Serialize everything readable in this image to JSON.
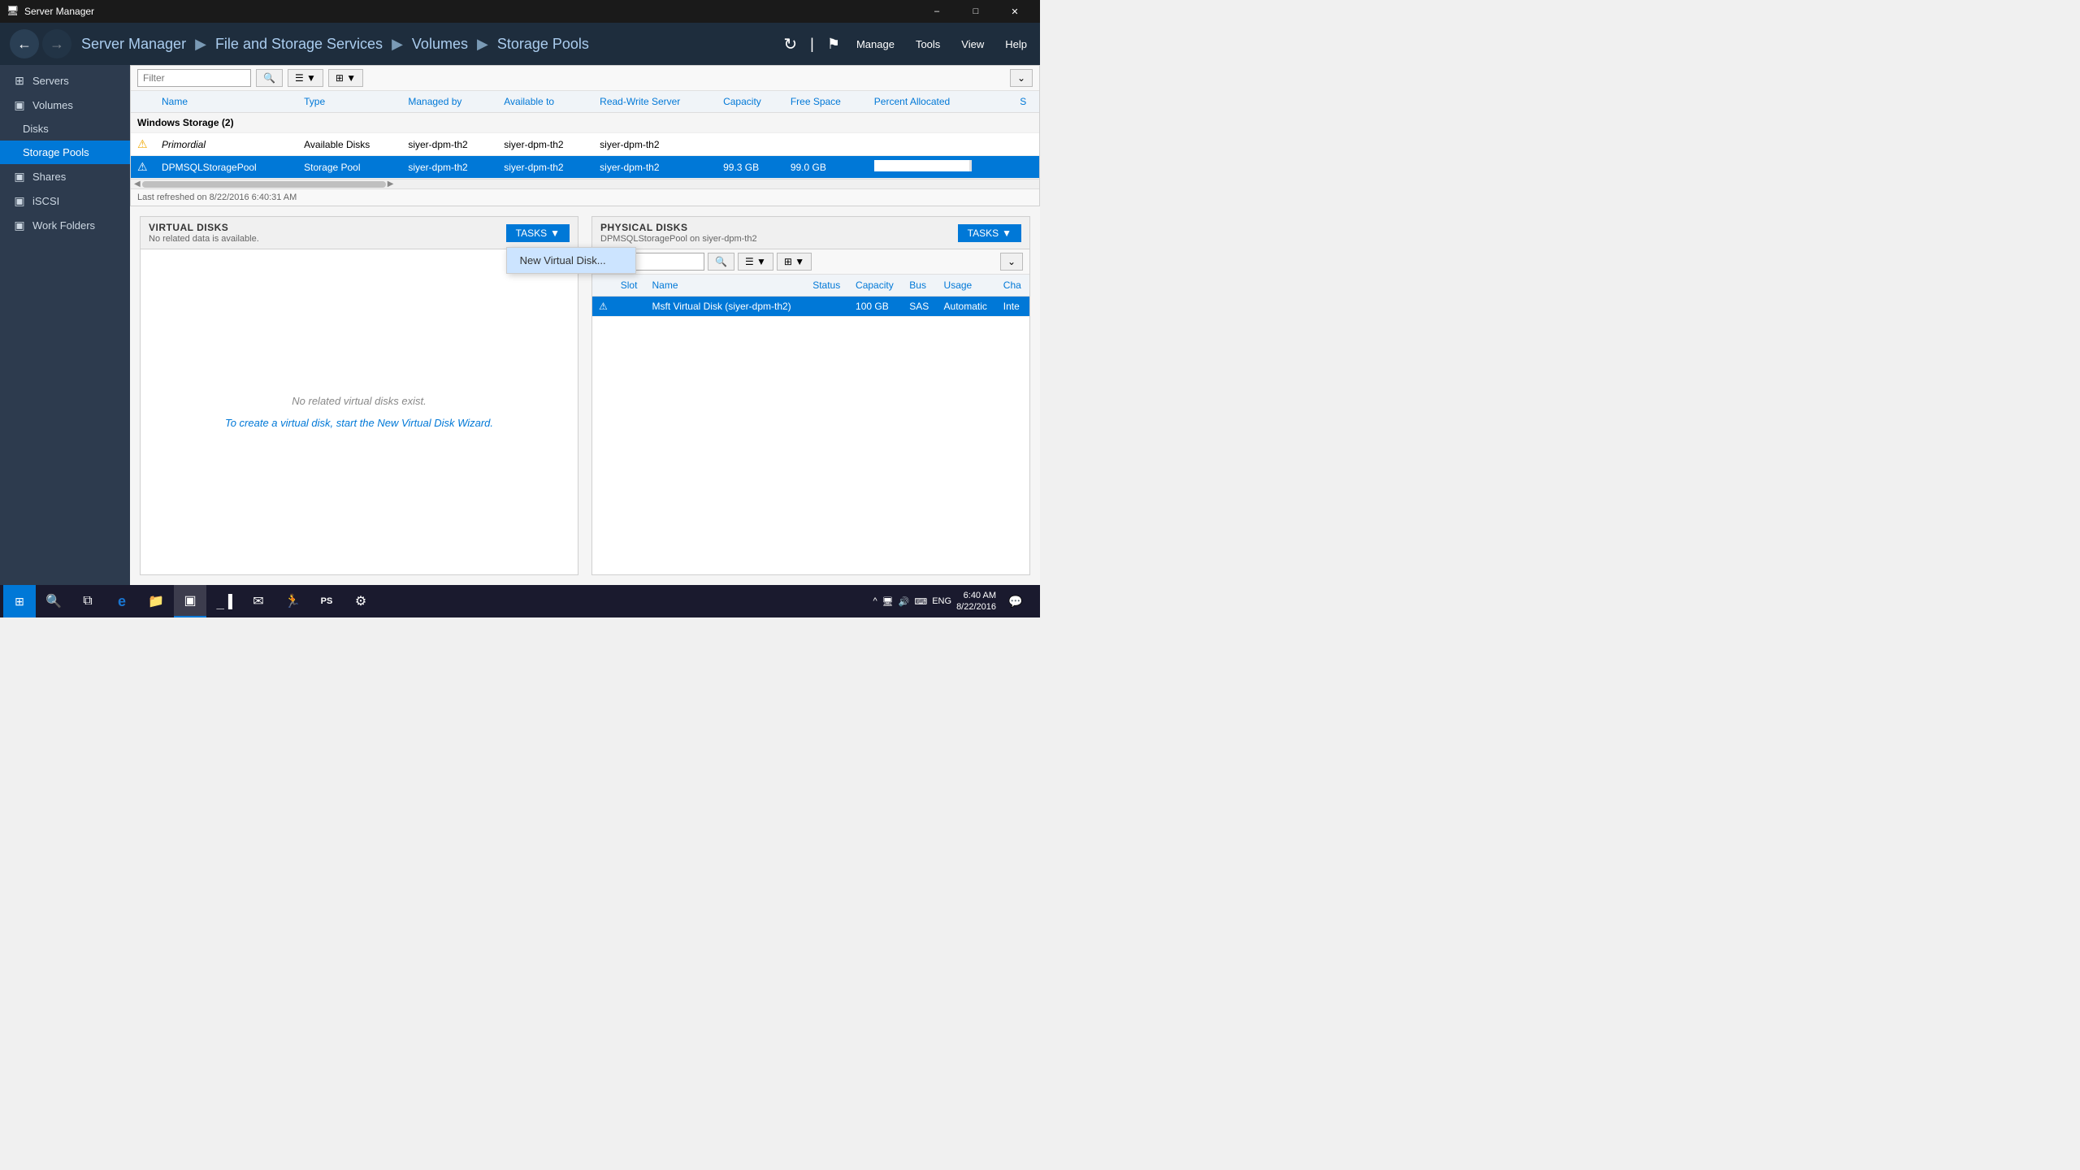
{
  "titleBar": {
    "icon": "🖥",
    "title": "Server Manager",
    "minimize": "–",
    "maximize": "□",
    "close": "✕"
  },
  "navBar": {
    "backBtn": "←",
    "forwardBtn": "→",
    "breadcrumb": {
      "root": "Server Manager",
      "sep1": "▶",
      "part1": "File and Storage Services",
      "sep2": "▶",
      "part2": "Volumes",
      "sep3": "▶",
      "part3": "Storage Pools"
    },
    "refreshBtn": "↻",
    "flagBtn": "⚑",
    "menus": [
      "Manage",
      "Tools",
      "View",
      "Help"
    ]
  },
  "sidebar": {
    "items": [
      {
        "id": "servers",
        "label": "Servers",
        "icon": "⊞"
      },
      {
        "id": "volumes",
        "label": "Volumes",
        "icon": "i"
      },
      {
        "id": "disks",
        "label": "Disks",
        "icon": "▣",
        "indent": true
      },
      {
        "id": "storage-pools",
        "label": "Storage Pools",
        "icon": "▣",
        "indent": true,
        "active": true
      },
      {
        "id": "shares",
        "label": "Shares",
        "icon": "▣"
      },
      {
        "id": "iscsi",
        "label": "iSCSI",
        "icon": "▣"
      },
      {
        "id": "work-folders",
        "label": "Work Folders",
        "icon": "▣"
      }
    ]
  },
  "storagePoolsPanel": {
    "filterPlaceholder": "Filter",
    "filterIcon": "🔍",
    "columns": {
      "name": "Name",
      "type": "Type",
      "managedBy": "Managed by",
      "availableTo": "Available to",
      "readWriteServer": "Read-Write Server",
      "capacity": "Capacity",
      "freeSpace": "Free Space",
      "percentAllocated": "Percent Allocated",
      "s": "S"
    },
    "groupHeader": "Windows Storage (2)",
    "rows": [
      {
        "name": "Primordial",
        "type": "Available Disks",
        "managedBy": "siyer-dpm-th2",
        "availableTo": "siyer-dpm-th2",
        "readWriteServer": "siyer-dpm-th2",
        "capacity": "",
        "freeSpace": "",
        "percentAllocated": "",
        "italic": true,
        "selected": false
      },
      {
        "name": "DPMSQLStoragePool",
        "type": "Storage Pool",
        "managedBy": "siyer-dpm-th2",
        "availableTo": "siyer-dpm-th2",
        "readWriteServer": "siyer-dpm-th2",
        "capacity": "99.3 GB",
        "freeSpace": "99.0 GB",
        "percentAllocated": "98",
        "barWidth": "98",
        "italic": false,
        "selected": true
      }
    ],
    "refreshInfo": "Last refreshed on 8/22/2016 6:40:31 AM"
  },
  "virtualDisks": {
    "title": "VIRTUAL DISKS",
    "subtitle": "No related data is available.",
    "tasksLabel": "TASKS",
    "noDataText": "No related virtual disks exist.",
    "createLink": "To create a virtual disk, start the New Virtual Disk Wizard.",
    "contextMenu": {
      "items": [
        "New Virtual Disk..."
      ]
    }
  },
  "physicalDisks": {
    "title": "PHYSICAL DISKS",
    "subtitle": "DPMSQLStoragePool on siyer-dpm-th2",
    "tasksLabel": "TASKS",
    "filterPlaceholder": "Filter",
    "columns": {
      "slot": "Slot",
      "name": "Name",
      "status": "Status",
      "capacity": "Capacity",
      "bus": "Bus",
      "usage": "Usage",
      "chassis": "Cha"
    },
    "rows": [
      {
        "slot": "",
        "name": "Msft Virtual Disk (siyer-dpm-th2)",
        "status": "",
        "capacity": "100 GB",
        "bus": "SAS",
        "usage": "Automatic",
        "chassis": "Inte",
        "selected": true
      }
    ]
  },
  "taskbar": {
    "startIcon": "⊞",
    "searchIcon": "🔍",
    "apps": [
      {
        "id": "explorer",
        "icon": "📁"
      },
      {
        "id": "ie",
        "icon": "e"
      },
      {
        "id": "files",
        "icon": "📂"
      },
      {
        "id": "server-mgr",
        "icon": "▣",
        "active": true
      },
      {
        "id": "cmd",
        "icon": ">"
      },
      {
        "id": "outlook",
        "icon": "✉"
      },
      {
        "id": "run",
        "icon": "🏃"
      },
      {
        "id": "ps",
        "icon": "PS"
      },
      {
        "id": "config",
        "icon": "⚙"
      }
    ],
    "tray": {
      "chevron": "^",
      "network": "🖥",
      "volume": "🔊",
      "keyboard": "⌨",
      "language": "ENG",
      "time": "6:40 AM",
      "date": "8/22/2016",
      "notify": "💬"
    }
  }
}
